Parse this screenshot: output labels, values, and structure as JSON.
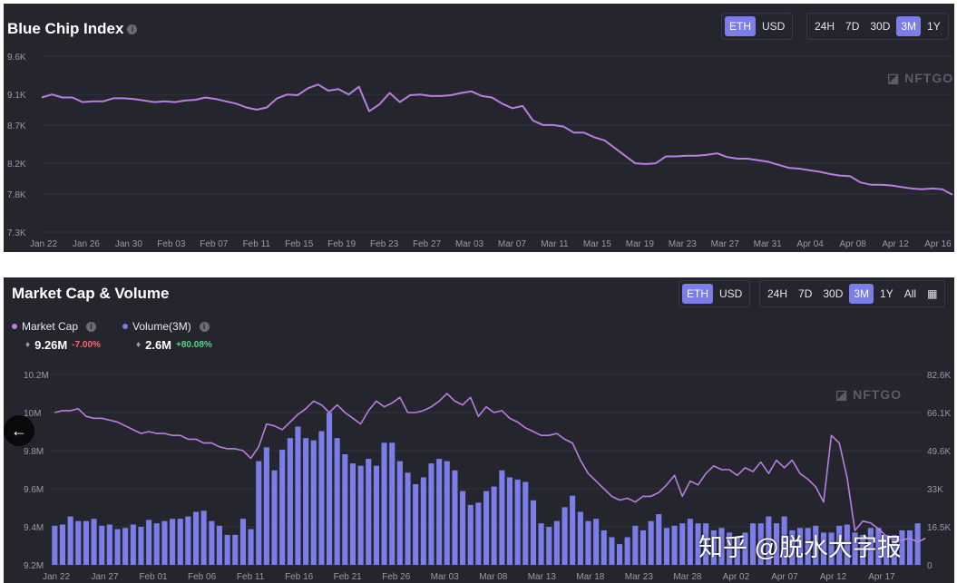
{
  "panel1": {
    "title": "Blue Chip Index",
    "currency_toggle": [
      "ETH",
      "USD"
    ],
    "active_currency": "ETH",
    "range_toggle": [
      "24H",
      "7D",
      "30D",
      "3M",
      "1Y"
    ],
    "active_range": "3M",
    "watermark": "NFTGO"
  },
  "panel2": {
    "title": "Market Cap & Volume",
    "currency_toggle": [
      "ETH",
      "USD"
    ],
    "active_currency": "ETH",
    "range_toggle": [
      "24H",
      "7D",
      "30D",
      "3M",
      "1Y",
      "All"
    ],
    "active_range": "3M",
    "watermark": "NFTGO",
    "legend": [
      {
        "label": "Market Cap",
        "value": "9.26M",
        "change": "-7.00%",
        "change_color": "#f26b6b",
        "dot_color": "#b77fe0"
      },
      {
        "label": "Volume(3M)",
        "value": "2.6M",
        "change": "+80.08%",
        "change_color": "#5fd08a",
        "dot_color": "#7b7de8"
      }
    ]
  },
  "overlay": {
    "back_arrow": "←",
    "watermark_text": "知乎 @脱水大字报"
  },
  "colors": {
    "line": "#b77fe0",
    "bars": "#7b7de8",
    "panel_bg": "#25252e",
    "axis_text": "#9a9aa8"
  },
  "chart_data": [
    {
      "type": "line",
      "title": "Blue Chip Index",
      "yticks": [
        "9.6K",
        "9.1K",
        "8.7K",
        "8.2K",
        "7.8K",
        "7.3K"
      ],
      "ytick_values": [
        9600,
        9100,
        8700,
        8200,
        7800,
        7300
      ],
      "ylim": [
        7300,
        9600
      ],
      "xticks": [
        "Jan 22",
        "Jan 26",
        "Jan 30",
        "Feb 03",
        "Feb 07",
        "Feb 11",
        "Feb 15",
        "Feb 19",
        "Feb 23",
        "Feb 27",
        "Mar 03",
        "Mar 07",
        "Mar 11",
        "Mar 15",
        "Mar 19",
        "Mar 23",
        "Mar 27",
        "Mar 31",
        "Apr 04",
        "Apr 08",
        "Apr 12",
        "Apr 16"
      ],
      "series": [
        {
          "values": [
            9060,
            9100,
            9060,
            9060,
            9000,
            9010,
            9010,
            9050,
            9050,
            9040,
            9020,
            9000,
            9010,
            9000,
            9020,
            9030,
            9060,
            9040,
            9010,
            8980,
            8930,
            8900,
            8930,
            9050,
            9100,
            9090,
            9180,
            9230,
            9150,
            9170,
            9100,
            9200,
            8880,
            8970,
            9120,
            9000,
            9090,
            9100,
            9080,
            9080,
            9090,
            9120,
            9140,
            9080,
            9060,
            8980,
            8920,
            8950,
            8760,
            8700,
            8700,
            8680,
            8600,
            8600,
            8540,
            8500,
            8400,
            8300,
            8200,
            8190,
            8200,
            8290,
            8290,
            8300,
            8300,
            8310,
            8330,
            8280,
            8260,
            8260,
            8240,
            8220,
            8180,
            8140,
            8130,
            8110,
            8090,
            8060,
            8040,
            8030,
            7950,
            7920,
            7920,
            7910,
            7890,
            7870,
            7860,
            7870,
            7860,
            7790
          ]
        }
      ]
    },
    {
      "type": "bar",
      "title": "Market Cap & Volume",
      "left_yticks": [
        "10.2M",
        "10M",
        "9.8M",
        "9.6M",
        "9.4M",
        "9.2M"
      ],
      "left_ylim": [
        9200000,
        10200000
      ],
      "right_yticks": [
        "82.6K",
        "66.1K",
        "49.6K",
        "33K",
        "16.5K",
        "0"
      ],
      "right_ylim": [
        0,
        82600
      ],
      "xticks": [
        "Jan 22",
        "Jan 27",
        "Feb 01",
        "Feb 06",
        "Feb 11",
        "Feb 16",
        "Feb 21",
        "Feb 26",
        "Mar 03",
        "Mar 08",
        "Mar 13",
        "Mar 18",
        "Mar 23",
        "Mar 28",
        "Apr 02",
        "Apr 07",
        "Apr 12",
        "Apr 17"
      ],
      "series": [
        {
          "name": "Market Cap",
          "type": "line",
          "axis": "left",
          "values": [
            10000000,
            10010000,
            10010000,
            10020000,
            9980000,
            9970000,
            9970000,
            9960000,
            9950000,
            9930000,
            9910000,
            9890000,
            9900000,
            9890000,
            9890000,
            9880000,
            9880000,
            9860000,
            9860000,
            9840000,
            9840000,
            9820000,
            9810000,
            9810000,
            9800000,
            9760000,
            9820000,
            9940000,
            9930000,
            9910000,
            9950000,
            9990000,
            10020000,
            10060000,
            10040000,
            10000000,
            10040000,
            10000000,
            9970000,
            9940000,
            10010000,
            10060000,
            10030000,
            10050000,
            10080000,
            10000000,
            10000000,
            10010000,
            10030000,
            10060000,
            10100000,
            10060000,
            10040000,
            10080000,
            9980000,
            10030000,
            10000000,
            10010000,
            9970000,
            9950000,
            9920000,
            9900000,
            9880000,
            9880000,
            9890000,
            9860000,
            9840000,
            9750000,
            9680000,
            9640000,
            9600000,
            9560000,
            9540000,
            9550000,
            9530000,
            9560000,
            9560000,
            9580000,
            9620000,
            9670000,
            9560000,
            9640000,
            9620000,
            9680000,
            9720000,
            9700000,
            9700000,
            9670000,
            9710000,
            9690000,
            9740000,
            9680000,
            9750000,
            9710000,
            9750000,
            9680000,
            9650000,
            9610000,
            9530000,
            9880000,
            9840000,
            9660000,
            9380000,
            9430000,
            9420000,
            9390000,
            9350000,
            9330000,
            9330000,
            9340000,
            9320000,
            9340000
          ]
        },
        {
          "name": "Volume(3M)",
          "type": "bar",
          "axis": "right",
          "values": [
            17000,
            17500,
            21000,
            19000,
            19000,
            20000,
            17000,
            17500,
            15500,
            16000,
            17500,
            16500,
            19500,
            18000,
            19000,
            20000,
            20000,
            21000,
            23000,
            23500,
            19000,
            17000,
            13000,
            13000,
            20000,
            15500,
            45000,
            51000,
            41000,
            50000,
            55000,
            60000,
            55000,
            54000,
            58000,
            66000,
            55000,
            48000,
            44000,
            43000,
            46000,
            43000,
            53000,
            53000,
            45000,
            40000,
            35000,
            38000,
            44000,
            46000,
            45000,
            41000,
            32000,
            26000,
            27000,
            32000,
            34000,
            41000,
            38000,
            37000,
            36000,
            28000,
            18000,
            16500,
            19000,
            25000,
            30000,
            23000,
            19000,
            20000,
            15000,
            12000,
            9000,
            12000,
            17000,
            15000,
            19000,
            22000,
            16000,
            17000,
            18000,
            20000,
            18000,
            18000,
            15000,
            16000,
            14000,
            12000,
            14000,
            18000,
            18000,
            21000,
            18000,
            21000,
            15000,
            16000,
            16000,
            17000,
            14000,
            14000,
            17000,
            17500,
            14000,
            13000,
            16000,
            16000,
            13000,
            13000,
            15000,
            15000,
            18000
          ]
        }
      ]
    }
  ]
}
